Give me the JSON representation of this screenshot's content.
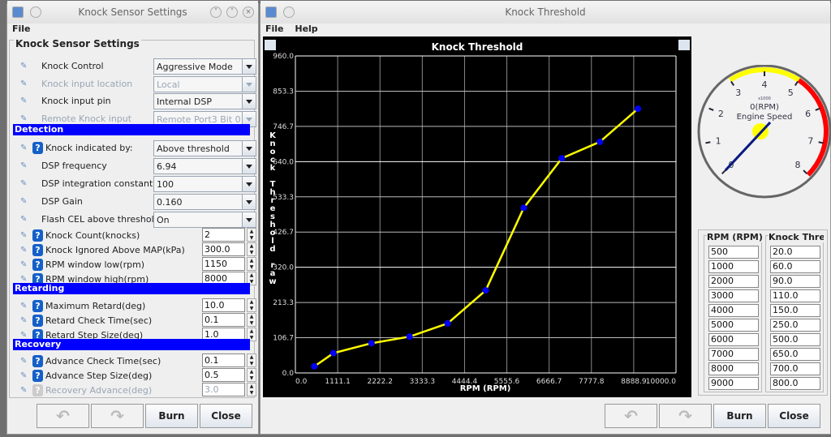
{
  "left_window": {
    "title": "Knock Sensor Settings",
    "menu": [
      "File"
    ],
    "group_title": "Knock Sensor Settings",
    "rows_top": [
      {
        "label": "Knock Control",
        "value": "Aggressive Mode",
        "enabled": true
      },
      {
        "label": "Knock input location",
        "value": "Local",
        "enabled": false
      },
      {
        "label": "Knock input pin",
        "value": "Internal DSP",
        "enabled": true
      },
      {
        "label": "Remote Knock input",
        "value": "Remote Port3 Bit 0",
        "enabled": false
      }
    ],
    "sections": [
      "Detection",
      "Retarding",
      "Recovery"
    ],
    "detection_combos": [
      {
        "label": "Knock indicated by:",
        "value": "Above threshold",
        "help": true
      },
      {
        "label": "DSP frequency",
        "value": "6.94"
      },
      {
        "label": "DSP integration constant",
        "value": "100"
      },
      {
        "label": "DSP Gain",
        "value": "0.160"
      },
      {
        "label": "Flash CEL above threshold",
        "value": "On"
      }
    ],
    "detection_spins": [
      {
        "label": "Knock Count(knocks)",
        "value": "2"
      },
      {
        "label": "Knock Ignored Above MAP(kPa)",
        "value": "300.0"
      },
      {
        "label": "RPM window low(rpm)",
        "value": "1150"
      },
      {
        "label": "RPM window high(rpm)",
        "value": "8000"
      }
    ],
    "retarding": [
      {
        "label": "Maximum Retard(deg)",
        "value": "10.0"
      },
      {
        "label": "Retard Check Time(sec)",
        "value": "0.1"
      },
      {
        "label": "Retard Step Size(deg)",
        "value": "1.0"
      }
    ],
    "recovery": [
      {
        "label": "Advance Check Time(sec)",
        "value": "0.1"
      },
      {
        "label": "Advance Step Size(deg)",
        "value": "0.5"
      },
      {
        "label": "Recovery Advance(deg)",
        "value": "3.0",
        "enabled": false
      }
    ],
    "buttons": {
      "burn": "Burn",
      "close": "Close"
    }
  },
  "right_window": {
    "title": "Knock Threshold",
    "menu": [
      "File",
      "Help"
    ],
    "gauge": {
      "title": "Engine Speed",
      "readout": "0(RPM)",
      "multiplier": "x1000",
      "ticks": [
        "0",
        "1",
        "2",
        "3",
        "4",
        "5",
        "6",
        "7",
        "8"
      ],
      "value": 0
    },
    "table": {
      "headers": [
        "RPM (RPM)",
        "Knock Threshold"
      ],
      "rpm": [
        "500",
        "1000",
        "2000",
        "3000",
        "4000",
        "5000",
        "6000",
        "7000",
        "8000",
        "9000"
      ],
      "threshold": [
        "20.0",
        "60.0",
        "90.0",
        "110.0",
        "150.0",
        "250.0",
        "500.0",
        "650.0",
        "700.0",
        "800.0"
      ]
    },
    "buttons": {
      "burn": "Burn",
      "close": "Close"
    },
    "colors": {
      "line": "#ffff00",
      "point": "#0000ff",
      "background": "#000000"
    }
  },
  "chart_data": {
    "type": "line",
    "title": "Knock Threshold",
    "xlabel": "RPM (RPM)",
    "ylabel": "Knock Threshold raw",
    "xlim": [
      0,
      10000
    ],
    "ylim": [
      0,
      960
    ],
    "xticks": [
      "0.0",
      "1111.1",
      "2222.2",
      "3333.3",
      "4444.4",
      "5555.6",
      "6666.7",
      "7777.8",
      "8888.9",
      "10000.0"
    ],
    "yticks": [
      "0.0",
      "106.7",
      "213.3",
      "320.0",
      "426.7",
      "533.3",
      "640.0",
      "746.7",
      "853.3",
      "960.0"
    ],
    "grid": true,
    "x": [
      500,
      1000,
      2000,
      3000,
      4000,
      5000,
      6000,
      7000,
      8000,
      9000
    ],
    "y": [
      20,
      60,
      90,
      110,
      150,
      250,
      500,
      650,
      700,
      800
    ]
  }
}
